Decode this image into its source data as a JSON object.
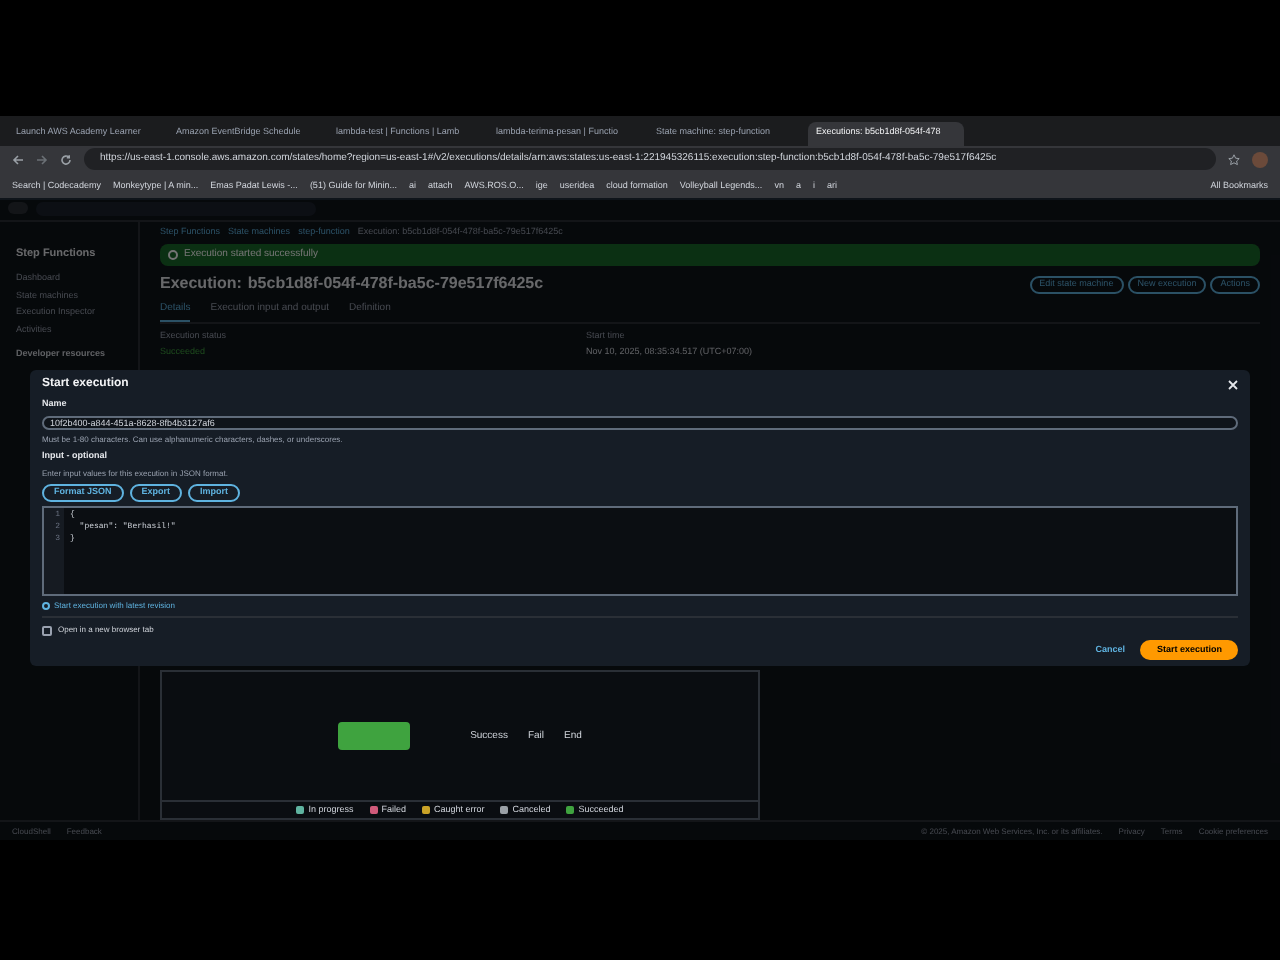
{
  "browser": {
    "tabs": [
      {
        "label": "Launch AWS Academy Learner",
        "selected": false
      },
      {
        "label": "Amazon EventBridge Schedule",
        "selected": false
      },
      {
        "label": "lambda-test | Functions | Lamb",
        "selected": false
      },
      {
        "label": "lambda-terima-pesan | Functio",
        "selected": false
      },
      {
        "label": "State machine: step-function",
        "selected": false
      },
      {
        "label": "Executions: b5cb1d8f-054f-478",
        "selected": true
      }
    ],
    "url": "https://us-east-1.console.aws.amazon.com/states/home?region=us-east-1#/v2/executions/details/arn:aws:states:us-east-1:221945326115:execution:step-function:b5cb1d8f-054f-478f-ba5c-79e517f6425c",
    "bookmarks": [
      "Search | Codecademy",
      "Monkeytype | A min...",
      "Emas Padat Lewis -...",
      "(51) Guide for Minin...",
      "ai",
      "attach",
      "AWS.ROS.O...",
      "ige",
      "useridea",
      "cloud formation",
      "Volleyball Legends...",
      "vn",
      "a",
      "i",
      "ari"
    ],
    "all_bookmarks": "All Bookmarks"
  },
  "console": {
    "breadcrumbs": [
      "Step Functions",
      "State machines",
      "step-function",
      "Execution: b5cb1d8f-054f-478f-ba5c-79e517f6425c"
    ],
    "sidebar": {
      "title": "Step Functions",
      "items": [
        "Dashboard",
        "State machines",
        "Execution Inspector",
        "Activities"
      ],
      "section": "Developer resources"
    },
    "banner": "Execution started successfully",
    "heading_label": "Execution:",
    "heading_id": "b5cb1d8f-054f-478f-ba5c-79e517f6425c",
    "actions": [
      "Edit state machine",
      "New execution",
      "Actions"
    ],
    "tabs": [
      {
        "label": "Details",
        "selected": true
      },
      {
        "label": "Execution input and output",
        "selected": false
      },
      {
        "label": "Definition",
        "selected": false
      }
    ],
    "status_label": "Execution status",
    "status": "Succeeded",
    "start_label": "Start time",
    "start_value": "Nov 10, 2025, 08:35:34.517 (UTC+07:00)",
    "graph_nodes": [
      "Success",
      "Fail",
      "End"
    ],
    "legend": [
      {
        "label": "In progress",
        "color": "#5fb3a0"
      },
      {
        "label": "Failed",
        "color": "#d05a7a"
      },
      {
        "label": "Caught error",
        "color": "#c9a227"
      },
      {
        "label": "Canceled",
        "color": "#9aa0a6"
      },
      {
        "label": "Succeeded",
        "color": "#3fa33f"
      }
    ],
    "footer_left": [
      "CloudShell",
      "Feedback"
    ],
    "footer_right": [
      "© 2025, Amazon Web Services, Inc. or its affiliates.",
      "Privacy",
      "Terms",
      "Cookie preferences"
    ]
  },
  "modal": {
    "title": "Start execution",
    "name_label": "Name",
    "name_value": "10f2b400-a844-451a-8628-8fb4b3127af6",
    "name_hint": "Must be 1-80 characters. Can use alphanumeric characters, dashes, or underscores.",
    "input_label": "Input - optional",
    "input_hint": "Enter input values for this execution in JSON format.",
    "input_buttons": [
      "Format JSON",
      "Export",
      "Import"
    ],
    "code": [
      {
        "number": "1",
        "text": "{"
      },
      {
        "number": "2",
        "text": "  \"pesan\": \"Berhasil!\""
      },
      {
        "number": "3",
        "text": "}"
      }
    ],
    "revision_link": "Start execution with latest revision",
    "new_tab": {
      "label": "Open in a new browser tab",
      "checked": false
    },
    "cancel": "Cancel",
    "submit": "Start execution"
  }
}
